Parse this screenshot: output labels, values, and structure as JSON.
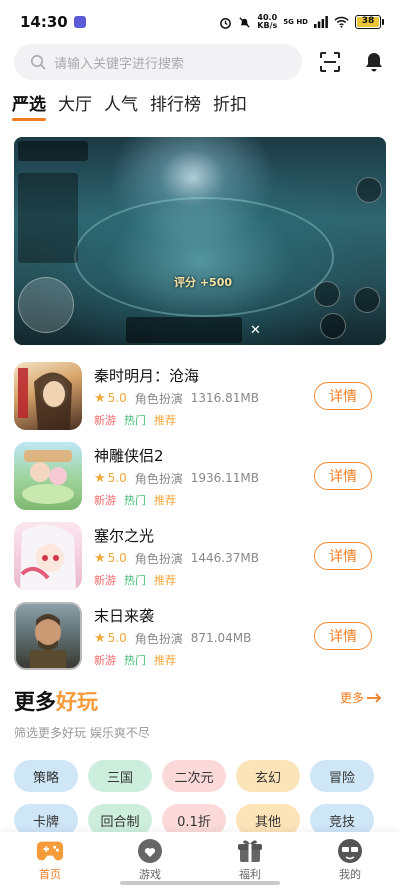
{
  "status_bar": {
    "time": "14:30",
    "speed_value": "40.0",
    "speed_unit": "KB/s",
    "network": "5G HD",
    "battery": "38"
  },
  "search": {
    "placeholder": "请输入关键字进行搜索"
  },
  "tabs": [
    {
      "label": "严选",
      "active": true
    },
    {
      "label": "大厅",
      "active": false
    },
    {
      "label": "人气",
      "active": false
    },
    {
      "label": "排行榜",
      "active": false
    },
    {
      "label": "折扣",
      "active": false
    }
  ],
  "banner": {
    "score_text": "评分 +500"
  },
  "games": [
    {
      "title": "秦时明月：沧海",
      "rating": "5.0",
      "genre": "角色扮演",
      "size": "1316.81MB",
      "tags": [
        "新游",
        "热门",
        "推荐"
      ],
      "button": "详情"
    },
    {
      "title": "神雕侠侣2",
      "rating": "5.0",
      "genre": "角色扮演",
      "size": "1936.11MB",
      "tags": [
        "新游",
        "热门",
        "推荐"
      ],
      "button": "详情"
    },
    {
      "title": "塞尔之光",
      "rating": "5.0",
      "genre": "角色扮演",
      "size": "1446.37MB",
      "tags": [
        "新游",
        "热门",
        "推荐"
      ],
      "button": "详情"
    },
    {
      "title": "末日来袭",
      "rating": "5.0",
      "genre": "角色扮演",
      "size": "871.04MB",
      "tags": [
        "新游",
        "热门",
        "推荐"
      ],
      "button": "详情"
    }
  ],
  "more": {
    "title_main": "更多",
    "title_accent": "好玩",
    "link": "更多",
    "subtitle": "筛选更多好玩 娱乐爽不尽"
  },
  "categories": [
    {
      "label": "策略",
      "color": "#cfe6f7"
    },
    {
      "label": "三国",
      "color": "#cdeedd"
    },
    {
      "label": "二次元",
      "color": "#fbd9d9"
    },
    {
      "label": "玄幻",
      "color": "#fde3b8"
    },
    {
      "label": "冒险",
      "color": "#cfe6f7"
    },
    {
      "label": "卡牌",
      "color": "#cfe6f7"
    },
    {
      "label": "回合制",
      "color": "#cdeedd"
    },
    {
      "label": "0.1折",
      "color": "#fbd9d9"
    },
    {
      "label": "其他",
      "color": "#fde3b8"
    },
    {
      "label": "竞技",
      "color": "#cfe6f7"
    }
  ],
  "bottom_nav": [
    {
      "label": "首页",
      "icon": "gamepad-icon",
      "active": true
    },
    {
      "label": "游戏",
      "icon": "game-heart-icon",
      "active": false
    },
    {
      "label": "福利",
      "icon": "gift-icon",
      "active": false
    },
    {
      "label": "我的",
      "icon": "profile-icon",
      "active": false
    }
  ],
  "colors": {
    "accent": "#f07c22",
    "tag_new": "#f06a6a",
    "tag_hot": "#3fbf73",
    "tag_rec": "#f2a93b"
  }
}
